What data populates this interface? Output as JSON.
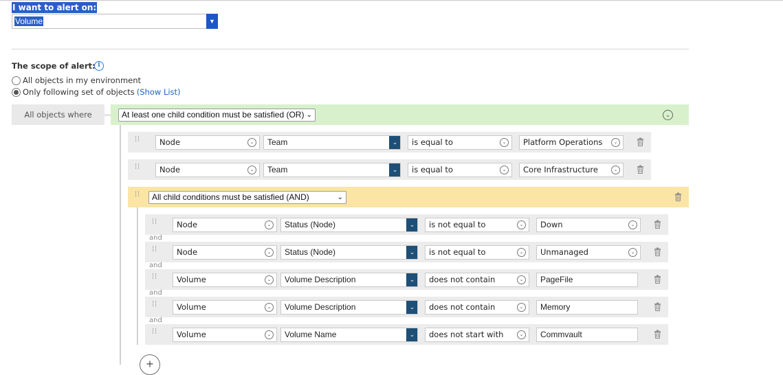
{
  "alert_on": {
    "label": "I want to alert on:",
    "value": "Volume"
  },
  "scope": {
    "label": "The scope of alert:",
    "options": [
      {
        "label": "All objects in my environment",
        "checked": false
      },
      {
        "label": "Only following set of objects",
        "checked": true,
        "link": "(Show List)"
      }
    ]
  },
  "all_objects_where": "All objects where",
  "or_group": {
    "operator": "At least one child condition must be satisfied (OR)",
    "conditions": [
      {
        "object": "Node",
        "property": "Team",
        "operator": "is equal to",
        "value": "Platform Operations"
      },
      {
        "object": "Node",
        "property": "Team",
        "operator": "is equal to",
        "value": "Core Infrastructure"
      }
    ]
  },
  "and_group": {
    "operator": "All child conditions must be satisfied (AND)",
    "join_label": "and",
    "conditions": [
      {
        "object": "Node",
        "property": "Status (Node)",
        "operator": "is not equal to",
        "value": "Down"
      },
      {
        "object": "Node",
        "property": "Status (Node)",
        "operator": "is not equal to",
        "value": "Unmanaged"
      },
      {
        "object": "Volume",
        "property": "Volume Description",
        "operator": "does not contain",
        "value": "PageFile"
      },
      {
        "object": "Volume",
        "property": "Volume Description",
        "operator": "does not contain",
        "value": "Memory"
      },
      {
        "object": "Volume",
        "property": "Volume Name",
        "operator": "does not start with",
        "value": "Commvault"
      }
    ]
  },
  "icons": {
    "info": "info-icon",
    "drag": "drag-handle-icon",
    "trash": "trash-icon",
    "collapse": "chevron-down-circle-icon",
    "add": "plus-icon"
  },
  "colors": {
    "or_group_bg": "#d8f1cc",
    "and_group_bg": "#fae5a5",
    "selection_blue": "#2a5fc6",
    "property_dropdown": "#1e4f76",
    "link": "#1a66c2"
  }
}
